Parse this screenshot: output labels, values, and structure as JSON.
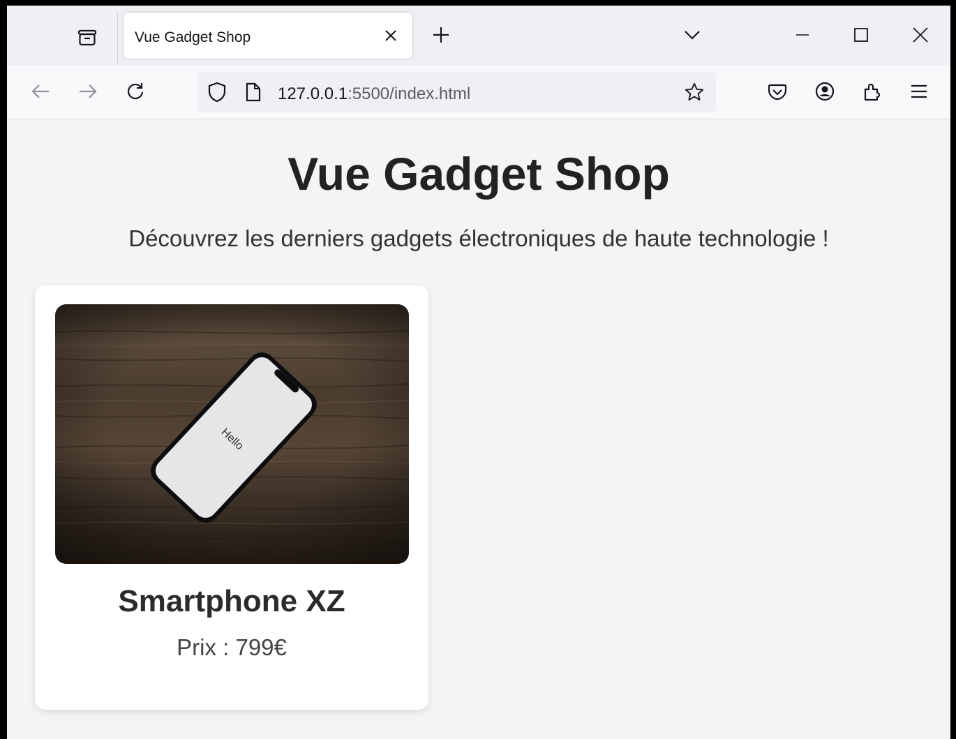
{
  "browser": {
    "tab": {
      "title": "Vue Gadget Shop"
    },
    "url": {
      "host": "127.0.0.1",
      "rest": ":5500/index.html"
    },
    "icons": {
      "tab_list": "tab-list-icon",
      "tab_close": "close-icon",
      "new_tab": "plus-icon",
      "tabs_menu": "chevron-down-icon",
      "minimize": "minimize-icon",
      "maximize": "maximize-icon",
      "close_window": "close-icon",
      "back": "arrow-left-icon",
      "forward": "arrow-right-icon",
      "reload": "reload-icon",
      "tracking": "shield-icon",
      "page_info": "page-icon",
      "bookmark": "star-icon",
      "pocket": "pocket-icon",
      "account": "account-icon",
      "extensions": "puzzle-icon",
      "menu": "hamburger-icon"
    }
  },
  "page": {
    "title": "Vue Gadget Shop",
    "subtitle": "Découvrez les derniers gadgets électroniques de haute technologie !"
  },
  "products": [
    {
      "name": "Smartphone XZ",
      "price": "Prix : 799€",
      "screen_text": "Hello"
    }
  ],
  "colors": {
    "page_background": "#f4f4f4",
    "card_background": "#ffffff",
    "title_color": "#222222",
    "wood_dark": "#2e241b",
    "wood_light": "#5a4a3b"
  }
}
